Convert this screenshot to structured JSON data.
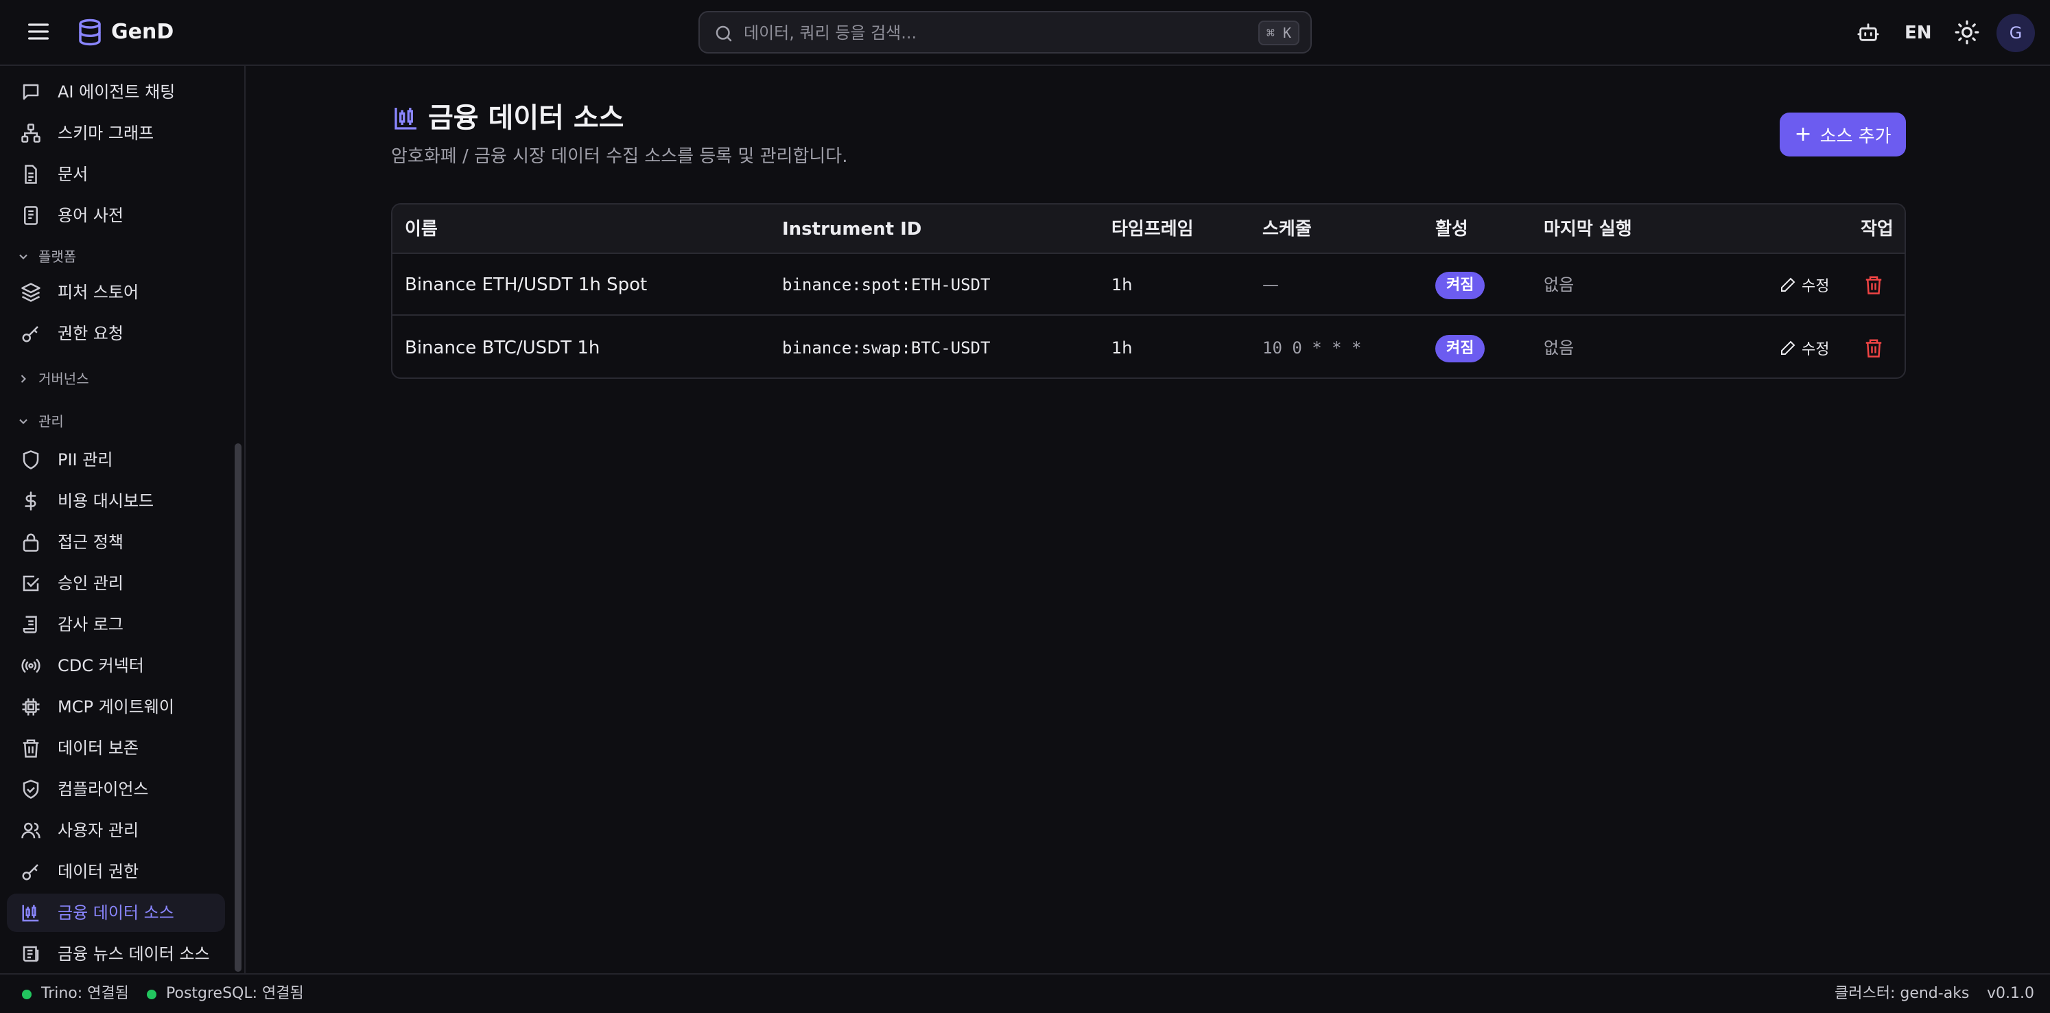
{
  "app": {
    "brand": "GenD"
  },
  "search": {
    "placeholder": "데이터, 쿼리 등을 검색...",
    "shortcut": "⌘ K"
  },
  "header": {
    "language": "EN",
    "avatar_initial": "G"
  },
  "sidebar": {
    "items": [
      {
        "label": "AI 에이전트 채팅",
        "icon": "chat-icon"
      },
      {
        "label": "스키마 그래프",
        "icon": "graph-icon"
      },
      {
        "label": "문서",
        "icon": "document-icon"
      },
      {
        "label": "용어 사전",
        "icon": "glossary-icon"
      },
      {
        "label": "피처 스토어",
        "icon": "layers-icon"
      },
      {
        "label": "권한 요청",
        "icon": "key-icon"
      },
      {
        "label": "PII 관리",
        "icon": "shield-icon"
      },
      {
        "label": "비용 대시보드",
        "icon": "dollar-icon"
      },
      {
        "label": "접근 정책",
        "icon": "lock-icon"
      },
      {
        "label": "승인 관리",
        "icon": "check-square-icon"
      },
      {
        "label": "감사 로그",
        "icon": "scroll-icon"
      },
      {
        "label": "CDC 커넥터",
        "icon": "broadcast-icon"
      },
      {
        "label": "MCP 게이트웨이",
        "icon": "chip-icon"
      },
      {
        "label": "데이터 보존",
        "icon": "trash-icon"
      },
      {
        "label": "컴플라이언스",
        "icon": "shield-check-icon"
      },
      {
        "label": "사용자 관리",
        "icon": "users-icon"
      },
      {
        "label": "데이터 권한",
        "icon": "key-icon"
      },
      {
        "label": "금융 데이터 소스",
        "icon": "chart-candle-icon"
      },
      {
        "label": "금융 뉴스 데이터 소스",
        "icon": "newspaper-icon"
      }
    ],
    "groups": {
      "platform": "플랫폼",
      "governance": "거버넌스",
      "management": "관리"
    }
  },
  "page": {
    "title": "금융 데이터 소스",
    "subtitle": "암호화폐 / 금융 시장 데이터 수집 소스를 등록 및 관리합니다.",
    "add_label": "소스 추가"
  },
  "table": {
    "columns": [
      "이름",
      "Instrument ID",
      "타임프레임",
      "스케줄",
      "활성",
      "마지막 실행",
      "작업"
    ],
    "rows": [
      {
        "name": "Binance ETH/USDT 1h Spot",
        "instrument_id": "binance:spot:ETH-USDT",
        "timeframe": "1h",
        "schedule": "—",
        "active": "켜짐",
        "last_run": "없음",
        "edit": "수정"
      },
      {
        "name": "Binance BTC/USDT 1h",
        "instrument_id": "binance:swap:BTC-USDT",
        "timeframe": "1h",
        "schedule": "10 0 * * *",
        "active": "켜짐",
        "last_run": "없음",
        "edit": "수정"
      }
    ]
  },
  "status": {
    "trino": "Trino: 연결됨",
    "postgres": "PostgreSQL: 연결됨",
    "cluster": "클러스터: gend-aks",
    "version": "v0.1.0"
  },
  "colors": {
    "accent": "#6c5cf0",
    "active_nav": "#8a86ff",
    "status_ok": "#22c55e",
    "danger": "#ef4444"
  }
}
